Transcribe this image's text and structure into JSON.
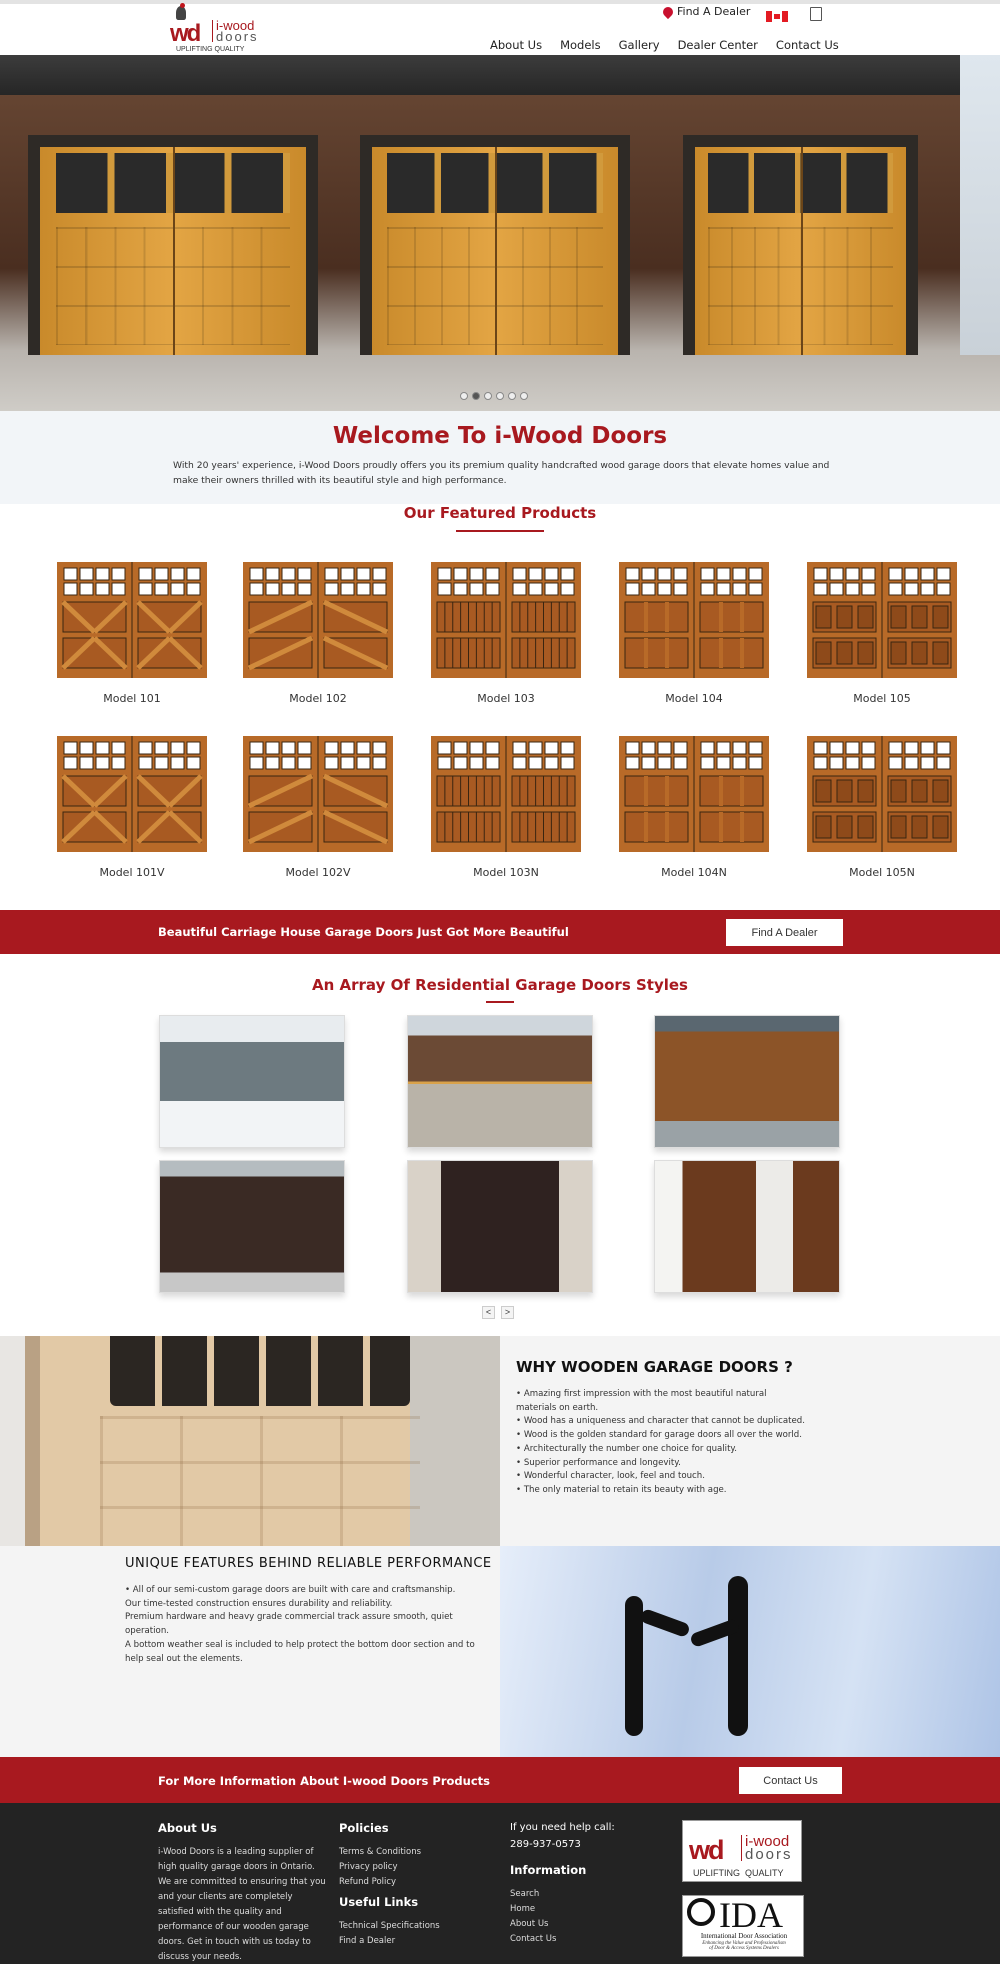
{
  "header": {
    "logo": {
      "mark": "wd",
      "name_top": "i-wood",
      "name_bottom": "doors",
      "tagline": "UPLIFTING QUALITY"
    },
    "find_dealer": "Find A Dealer",
    "icons": {
      "dealer": "map-pin-icon",
      "flag": "canada-flag-icon",
      "cart": "shopping-bag-icon"
    },
    "nav": [
      "About Us",
      "Models",
      "Gallery",
      "Dealer Center",
      "Contact Us"
    ]
  },
  "hero": {
    "slides": 6,
    "active_slide": 2
  },
  "welcome": {
    "title": "Welcome To i-Wood Doors",
    "text": "With 20 years' experience, i-Wood Doors proudly offers you its premium quality handcrafted wood garage doors that elevate homes value and make their owners thrilled with its beautiful style and high performance."
  },
  "featured": {
    "title": "Our Featured Products",
    "products": [
      "Model 101",
      "Model 102",
      "Model 103",
      "Model 104",
      "Model 105",
      "Model 101V",
      "Model 102V",
      "Model 103N",
      "Model 104N",
      "Model 105N"
    ]
  },
  "band1": {
    "text": "Beautiful Carriage House Garage Doors Just Got More Beautiful",
    "button": "Find A Dealer"
  },
  "gallery": {
    "title": "An Array Of Residential Garage Doors Styles",
    "prev": "<",
    "next": ">"
  },
  "why": {
    "title": "WHY WOODEN GARAGE DOORS ?",
    "items": [
      "Amazing first impression with the most beautiful natural materials on earth.",
      "Wood has a uniqueness and character that cannot be duplicated.",
      "Wood is the golden standard for garage doors all over the world.",
      "Architecturally the number one choice for quality.",
      "Superior performance and longevity.",
      "Wonderful character, look, feel and touch.",
      "The only material to retain its beauty with age."
    ]
  },
  "unique": {
    "title": "UNIQUE FEATURES BEHIND RELIABLE PERFORMANCE",
    "lines": [
      "• All of our semi-custom garage doors are built with care and craftsmanship.",
      "Our time-tested construction ensures durability and reliability.",
      "Premium hardware and heavy grade commercial track assure smooth, quiet operation.",
      "A bottom weather seal is included to help protect the bottom door section and to help seal out the elements."
    ]
  },
  "band2": {
    "text": "For More Information About I-wood Doors Products",
    "button": "Contact Us"
  },
  "footer": {
    "about_title": "About Us",
    "about_text": "i-Wood Doors is a leading supplier of high quality garage doors in Ontario. We are committed to ensuring that you and your clients are completely satisfied with the quality and performance of our wooden garage doors. Get in touch with us today to discuss your needs.",
    "policies_title": "Policies",
    "policies": [
      "Terms & Conditions",
      "Privacy policy",
      "Refund Policy"
    ],
    "useful_title": "Useful Links",
    "useful": [
      "Technical Specifications",
      "Find a Dealer"
    ],
    "help_label": "If you need help call:",
    "phone": "289-937-0573",
    "info_title": "Information",
    "info": [
      "Search",
      "Home",
      "About Us",
      "Contact Us"
    ],
    "ida_logo": {
      "mark": "IDA",
      "name": "International Door Association",
      "tagline": "Enhancing the Value and Professionalism of Door & Access Systems Dealers"
    }
  },
  "colors": {
    "brand_red": "#a8191f",
    "footer_bg": "#232323",
    "band_bg": "#f2f5f8"
  }
}
